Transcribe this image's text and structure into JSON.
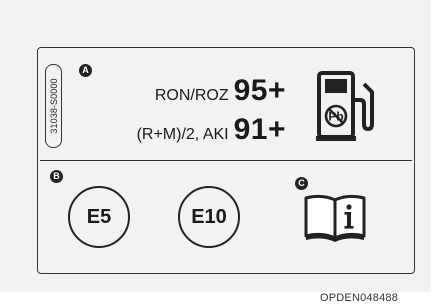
{
  "label": {
    "side_code": "31038-S0000",
    "markers": [
      "A",
      "B",
      "C"
    ],
    "fuel": [
      {
        "standard": "RON/ROZ",
        "rating": "95+"
      },
      {
        "standard": "(R+M)/2, AKI",
        "rating": "91+"
      }
    ],
    "blends": [
      "E5",
      "E10"
    ],
    "pump_icon": "fuel-pump-icon",
    "no_lead_icon": "no-lead-icon",
    "manual_icon": "info-manual-icon"
  },
  "figure_code": "OPDEN048488"
}
